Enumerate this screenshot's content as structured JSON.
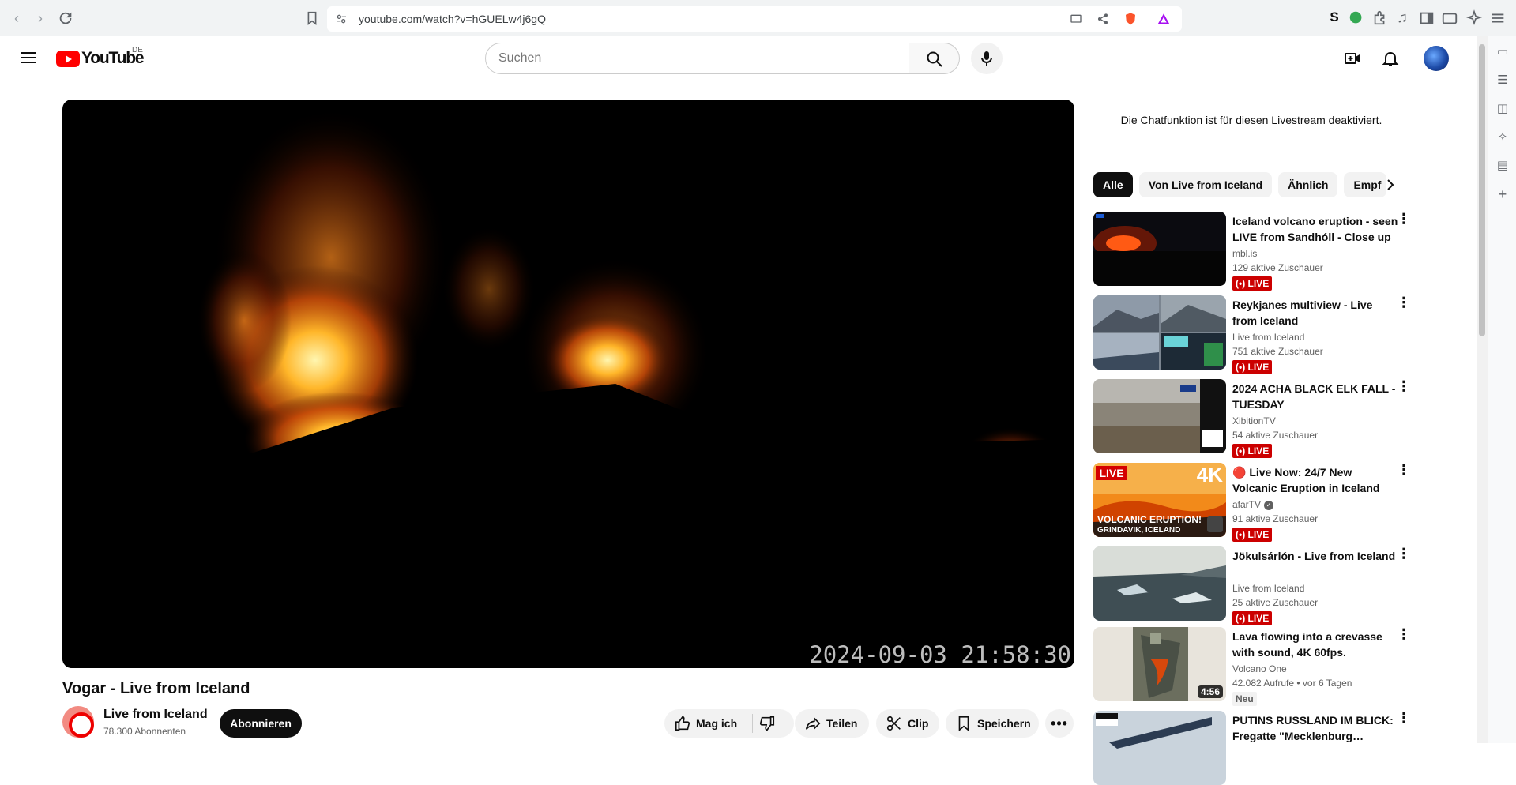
{
  "browser": {
    "url": "youtube.com/watch?v=hGUELw4j6gQ"
  },
  "header": {
    "logo_text": "YouTube",
    "region": "DE",
    "search_placeholder": "Suchen"
  },
  "video": {
    "overlay_timestamp": "2024-09-03 21:58:30",
    "title": "Vogar - Live from Iceland",
    "channel": "Live from Iceland",
    "subscribers": "78.300 Abonnenten",
    "subscribe_label": "Abonnieren",
    "actions": {
      "like": "Mag ich",
      "share": "Teilen",
      "clip": "Clip",
      "save": "Speichern"
    }
  },
  "sidebar": {
    "chat_disabled": "Die Chatfunktion ist für diesen Livestream deaktiviert.",
    "chips": [
      "Alle",
      "Von Live from Iceland",
      "Ähnlich",
      "Empf"
    ],
    "live_label": "LIVE",
    "new_label": "Neu",
    "recommendations": [
      {
        "title": "Iceland volcano eruption - seen LIVE from Sandhóll - Close up",
        "channel": "mbl.is",
        "meta": "129 aktive Zuschauer",
        "badge": "LIVE"
      },
      {
        "title": "Reykjanes multiview - Live from Iceland",
        "channel": "Live from Iceland",
        "meta": "751 aktive Zuschauer",
        "badge": "LIVE"
      },
      {
        "title": "2024 ACHA BLACK ELK FALL - TUESDAY",
        "channel": "XibitionTV",
        "meta": "54 aktive Zuschauer",
        "badge": "LIVE"
      },
      {
        "title": "🔴 Live Now: 24/7 New Volcanic Eruption in Iceland in…",
        "channel": "afarTV",
        "meta": "91 aktive Zuschauer",
        "badge": "LIVE",
        "thumb_text_top": "LIVE",
        "thumb_text_4k": "4K",
        "thumb_caption_1": "VOLCANIC ERUPTION!",
        "thumb_caption_2": "GRINDAVIK, ICELAND"
      },
      {
        "title": "Jökulsárlón - Live from Iceland",
        "channel": "Live from Iceland",
        "meta": "25 aktive Zuschauer",
        "badge": "LIVE"
      },
      {
        "title": "Lava flowing into a crevasse with sound, 4K 60fps. Iceland…",
        "channel": "Volcano One",
        "meta": "42.082 Aufrufe • vor 6 Tagen",
        "badge": "Neu",
        "duration": "4:56"
      },
      {
        "title": "PUTINS RUSSLAND IM BLICK: Fregatte \"Mecklenburg…",
        "channel": "",
        "meta": ""
      }
    ]
  }
}
